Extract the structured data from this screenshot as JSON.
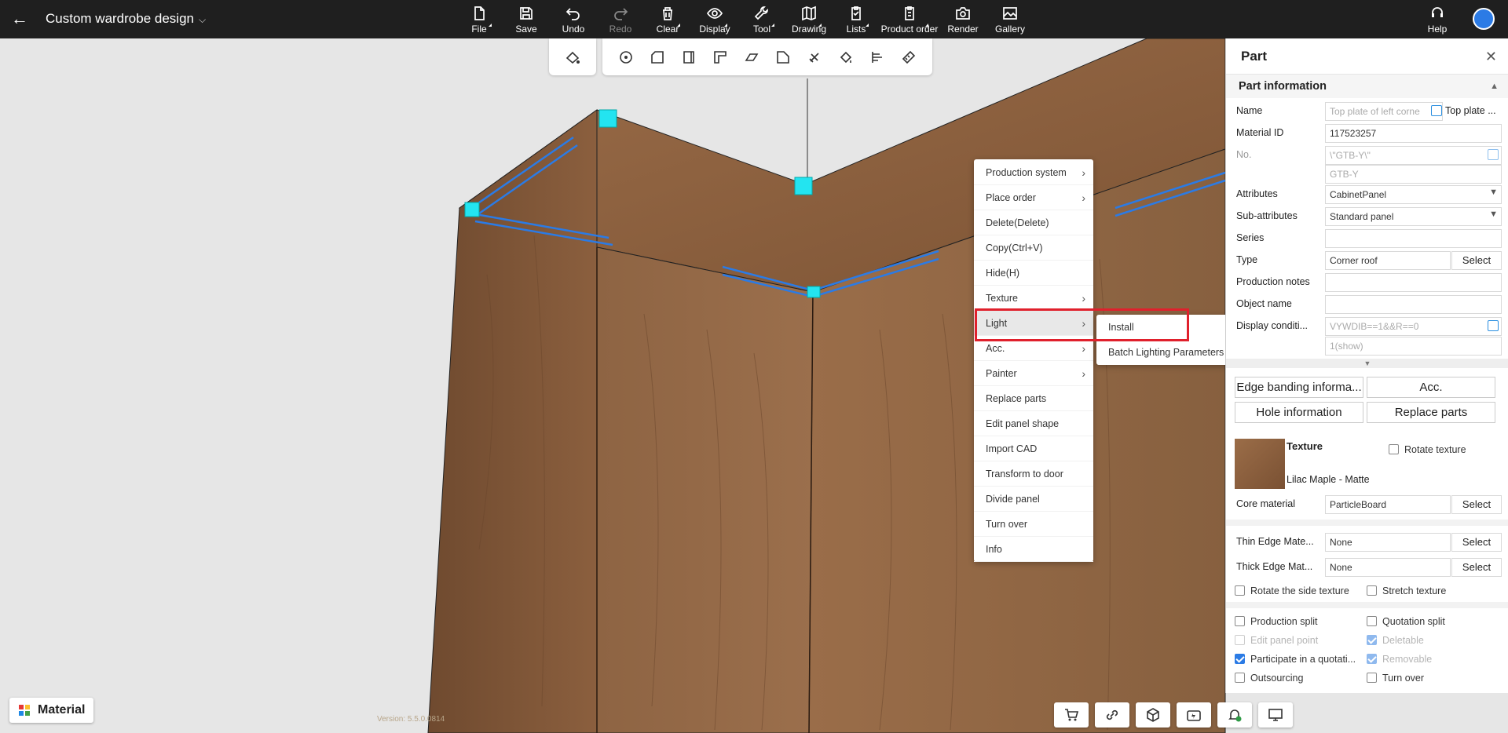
{
  "header": {
    "title": "Custom wardrobe design",
    "tools": [
      {
        "label": "File",
        "icon": "file-icon",
        "disabled": false
      },
      {
        "label": "Save",
        "icon": "save-icon",
        "disabled": false
      },
      {
        "label": "Undo",
        "icon": "undo-icon",
        "disabled": false
      },
      {
        "label": "Redo",
        "icon": "redo-icon",
        "disabled": true
      },
      {
        "label": "Clear",
        "icon": "clear-icon",
        "disabled": false
      },
      {
        "label": "Display",
        "icon": "eye-icon",
        "disabled": false
      },
      {
        "label": "Tool",
        "icon": "wrench-icon",
        "disabled": false
      },
      {
        "label": "Drawing",
        "icon": "map-icon",
        "disabled": false
      },
      {
        "label": "Lists",
        "icon": "clipboard-icon",
        "disabled": false
      },
      {
        "label": "Product order",
        "icon": "order-icon",
        "disabled": false
      },
      {
        "label": "Render",
        "icon": "camera-icon",
        "disabled": false
      },
      {
        "label": "Gallery",
        "icon": "image-icon",
        "disabled": false
      }
    ],
    "help_label": "Help"
  },
  "context_menu": {
    "items": [
      {
        "label": "Production system",
        "submenu": true
      },
      {
        "label": "Place order",
        "submenu": true
      },
      {
        "label": "Delete(Delete)",
        "submenu": false
      },
      {
        "label": "Copy(Ctrl+V)",
        "submenu": false
      },
      {
        "label": "Hide(H)",
        "submenu": false
      },
      {
        "label": "Texture",
        "submenu": true
      },
      {
        "label": "Light",
        "submenu": true
      },
      {
        "label": "Acc.",
        "submenu": true
      },
      {
        "label": "Painter",
        "submenu": true
      },
      {
        "label": "Replace parts",
        "submenu": false
      },
      {
        "label": "Edit panel shape",
        "submenu": false
      },
      {
        "label": "Import CAD",
        "submenu": false
      },
      {
        "label": "Transform to door",
        "submenu": false
      },
      {
        "label": "Divide panel",
        "submenu": false
      },
      {
        "label": "Turn over",
        "submenu": false
      },
      {
        "label": "Info",
        "submenu": false
      }
    ],
    "submenu_items": [
      "Install",
      "Batch Lighting Parameters"
    ]
  },
  "panel": {
    "title": "Part",
    "section": "Part information",
    "fields": {
      "name_label": "Name",
      "name_value": "Top plate of left corne",
      "name_extra": "Top plate ...",
      "material_id_label": "Material ID",
      "material_id_value": "117523257",
      "no_label": "No.",
      "no_value": "\\\"GTB-Y\\\"",
      "no_value2": "GTB-Y",
      "attributes_label": "Attributes",
      "attributes_value": "CabinetPanel",
      "subattr_label": "Sub-attributes",
      "subattr_value": "Standard panel",
      "series_label": "Series",
      "series_value": "",
      "type_label": "Type",
      "type_value": "Corner roof",
      "type_select": "Select",
      "notes_label": "Production notes",
      "notes_value": "",
      "object_label": "Object name",
      "object_value": "",
      "display_label": "Display conditi...",
      "display_value": "VYWDIB==1&&R==0",
      "display_value2": "1(show)"
    },
    "buttons": {
      "edge": "Edge banding informa...",
      "acc": "Acc.",
      "hole": "Hole information",
      "replace": "Replace parts"
    },
    "texture": {
      "label": "Texture",
      "name": "Lilac Maple - Matte",
      "rotate": "Rotate texture"
    },
    "core": {
      "label": "Core material",
      "value": "ParticleBoard",
      "select": "Select"
    },
    "thin": {
      "label": "Thin Edge Mate...",
      "value": "None",
      "select": "Select"
    },
    "thick": {
      "label": "Thick Edge Mat...",
      "value": "None",
      "select": "Select"
    },
    "checks": {
      "rotate_side": "Rotate the side texture",
      "stretch": "Stretch texture",
      "prod_split": "Production split",
      "quote_split": "Quotation split",
      "edit_point": "Edit panel point",
      "deletable": "Deletable",
      "participate": "Participate in a quotati...",
      "removable": "Removable",
      "outsourcing": "Outsourcing",
      "turn_over": "Turn over"
    }
  },
  "material_button": "Material",
  "version": "Version: 5.5.0.0814",
  "colors": {
    "accent": "#2b7be5",
    "highlight_red": "#e0202c",
    "wood": "#8a5f3e",
    "toolbar": "#1f1f1f"
  }
}
